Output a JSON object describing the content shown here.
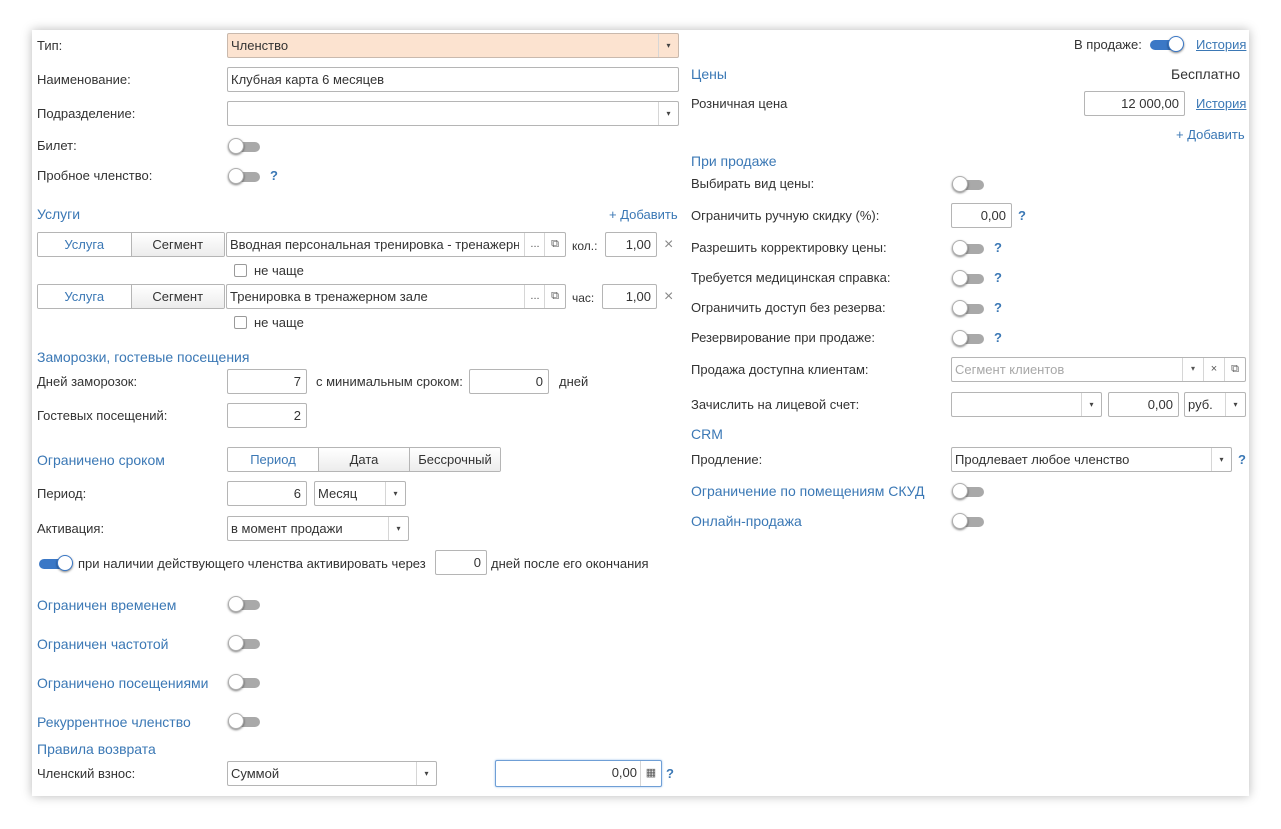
{
  "left": {
    "type": {
      "label": "Тип:",
      "value": "Членство"
    },
    "name": {
      "label": "Наименование:",
      "value": "Клубная карта 6 месяцев"
    },
    "division": {
      "label": "Подразделение:",
      "value": ""
    },
    "ticket": {
      "label": "Билет:"
    },
    "trial": {
      "label": "Пробное членство:",
      "help": "?"
    },
    "services": {
      "title": "Услуги",
      "add": "+ Добавить",
      "rows": [
        {
          "tab1": "Услуга",
          "tab2": "Сегмент",
          "value": "Вводная персональная тренировка - тренажерный зал",
          "more": "...",
          "qty_label": "кол.:",
          "qty": "1,00",
          "not_more_often": "не чаще"
        },
        {
          "tab1": "Услуга",
          "tab2": "Сегмент",
          "value": "Тренировка в тренажерном зале",
          "more": "...",
          "qty_label": "час:",
          "qty": "1,00",
          "not_more_often": "не чаще"
        }
      ]
    },
    "freeze": {
      "title": "Заморозки, гостевые посещения",
      "days_label": "Дней заморозок:",
      "days": "7",
      "min_term_label": "с минимальным сроком:",
      "min_term": "0",
      "days_unit": "дней",
      "guest_label": "Гостевых посещений:",
      "guest": "2"
    },
    "term": {
      "title": "Ограничено сроком",
      "tabs": [
        "Период",
        "Дата",
        "Бессрочный"
      ],
      "period_label": "Период:",
      "period_value": "6",
      "period_unit": "Месяц",
      "activation_label": "Активация:",
      "activation_value": "в момент продажи",
      "activate_text": "при наличии действующего членства активировать через",
      "activate_days": "0",
      "activate_after": "дней после его окончания"
    },
    "limited_time": "Ограничен временем",
    "limited_freq": "Ограничен частотой",
    "limited_visits": "Ограничено посещениями",
    "recurrent": "Рекуррентное членство",
    "refund": {
      "title": "Правила возврата",
      "fee_label": "Членский взнос:",
      "fee_mode": "Суммой",
      "fee_value": "0,00",
      "help": "?"
    }
  },
  "right": {
    "on_sale_label": "В продаже:",
    "history1": "История",
    "prices_title": "Цены",
    "free": "Бесплатно",
    "retail_label": "Розничная цена",
    "retail_value": "12 000,00",
    "history2": "История",
    "add": "+ Добавить",
    "on_sale_title": "При продаже",
    "choose_price": "Выбирать вид цены:",
    "limit_discount": "Ограничить ручную скидку (%):",
    "limit_discount_value": "0,00",
    "allow_correction": "Разрешить корректировку цены:",
    "med_cert": "Требуется медицинская справка:",
    "limit_access": "Ограничить доступ без резерва:",
    "reserve_on_sale": "Резервирование при продаже:",
    "available_clients": "Продажа доступна клиентам:",
    "segment_placeholder": "Сегмент клиентов",
    "credit_account": "Зачислить на лицевой счет:",
    "credit_account_value": "",
    "credit_amount": "0,00",
    "currency": "руб.",
    "crm_title": "CRM",
    "renewal_label": "Продление:",
    "renewal_value": "Продлевает любое членство",
    "skud": "Ограничение по помещениям СКУД",
    "online_sale": "Онлайн-продажа",
    "help": "?"
  },
  "icons": {
    "dropdown": "▾",
    "open": "⧉",
    "clear": "×",
    "calc": "▦"
  }
}
